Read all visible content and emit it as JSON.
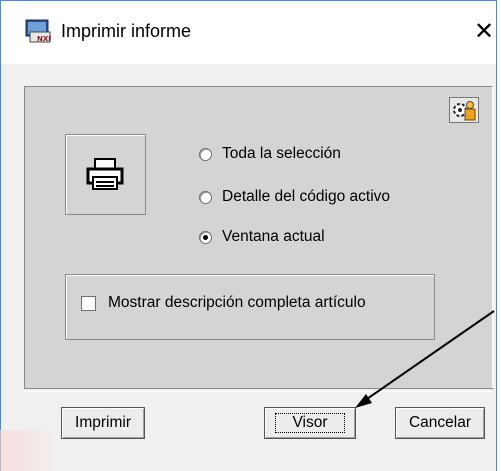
{
  "window": {
    "title": "Imprimir informe",
    "icon": "app-printer-icon",
    "close_glyph": "✕"
  },
  "options": {
    "radios": [
      {
        "label": "Toda la selección",
        "checked": false
      },
      {
        "label": "Detalle del código activo",
        "checked": false
      },
      {
        "label": "Ventana actual",
        "checked": true
      }
    ],
    "checkbox": {
      "label": "Mostrar descripción completa artículo",
      "checked": false
    }
  },
  "buttons": {
    "print_label": "Imprimir",
    "viewer_label": "Visor",
    "cancel_label": "Cancelar"
  },
  "annotation": {
    "color": "#000000"
  }
}
